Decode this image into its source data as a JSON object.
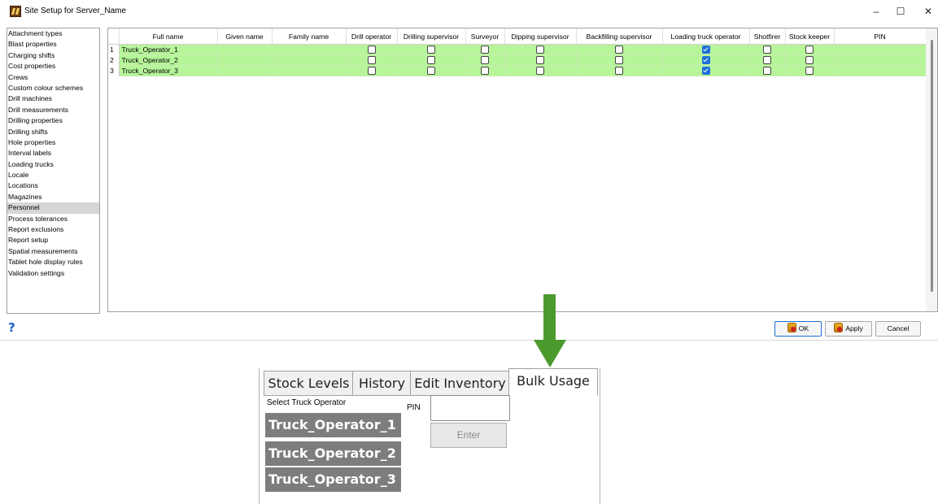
{
  "window": {
    "title": "Site Setup for  Server_Name",
    "controls": {
      "minimize": "–",
      "maximize": "☐",
      "close": "✕"
    }
  },
  "categories": [
    "Attachment types",
    "Blast properties",
    "Charging shifts",
    "Cost properties",
    "Crews",
    "Custom colour schemes",
    "Drill machines",
    "Drill measurements",
    "Drilling properties",
    "Drilling shifts",
    "Hole properties",
    "Interval labels",
    "Loading trucks",
    "Locale",
    "Locations",
    "Magazines",
    "Personnel",
    "Process tolerances",
    "Report exclusions",
    "Report setup",
    "Spatial measurements",
    "Tablet hole display rules",
    "Validation settings"
  ],
  "selected_category": "Personnel",
  "grid": {
    "columns": [
      "Full name",
      "Given name",
      "Family name",
      "Drill operator",
      "Drilling supervisor",
      "Surveyor",
      "Dipping supervisor",
      "Backfilling supervisor",
      "Loading truck operator",
      "Shotfirer",
      "Stock keeper",
      "PIN"
    ],
    "rows": [
      {
        "num": "1",
        "full_name": "Truck_Operator_1",
        "given_name": "",
        "family_name": "",
        "checks": [
          false,
          false,
          false,
          false,
          false,
          true,
          false,
          false
        ],
        "pin": ""
      },
      {
        "num": "2",
        "full_name": "Truck_Operator_2",
        "given_name": "",
        "family_name": "",
        "checks": [
          false,
          false,
          false,
          false,
          false,
          true,
          false,
          false
        ],
        "pin": ""
      },
      {
        "num": "3",
        "full_name": "Truck_Operator_3",
        "given_name": "",
        "family_name": "",
        "checks": [
          false,
          false,
          false,
          false,
          false,
          true,
          false,
          false
        ],
        "pin": ""
      }
    ]
  },
  "buttons": {
    "help": "?",
    "ok": "OK",
    "apply": "Apply",
    "cancel": "Cancel"
  },
  "bulk_panel": {
    "tabs": [
      "Stock Levels",
      "History",
      "Edit Inventory",
      "Bulk Usage"
    ],
    "active_tab": "Bulk Usage",
    "select_label": "Select Truck Operator",
    "pin_label": "PIN",
    "pin_value": "",
    "enter_label": "Enter",
    "operators": [
      "Truck_Operator_1",
      "Truck_Operator_2",
      "Truck_Operator_3"
    ]
  },
  "colors": {
    "row_highlight": "#b6f59a",
    "checkbox_checked": "#1e6fd9",
    "arrow": "#4b9a2e",
    "operator_button": "#7d7d7d"
  }
}
